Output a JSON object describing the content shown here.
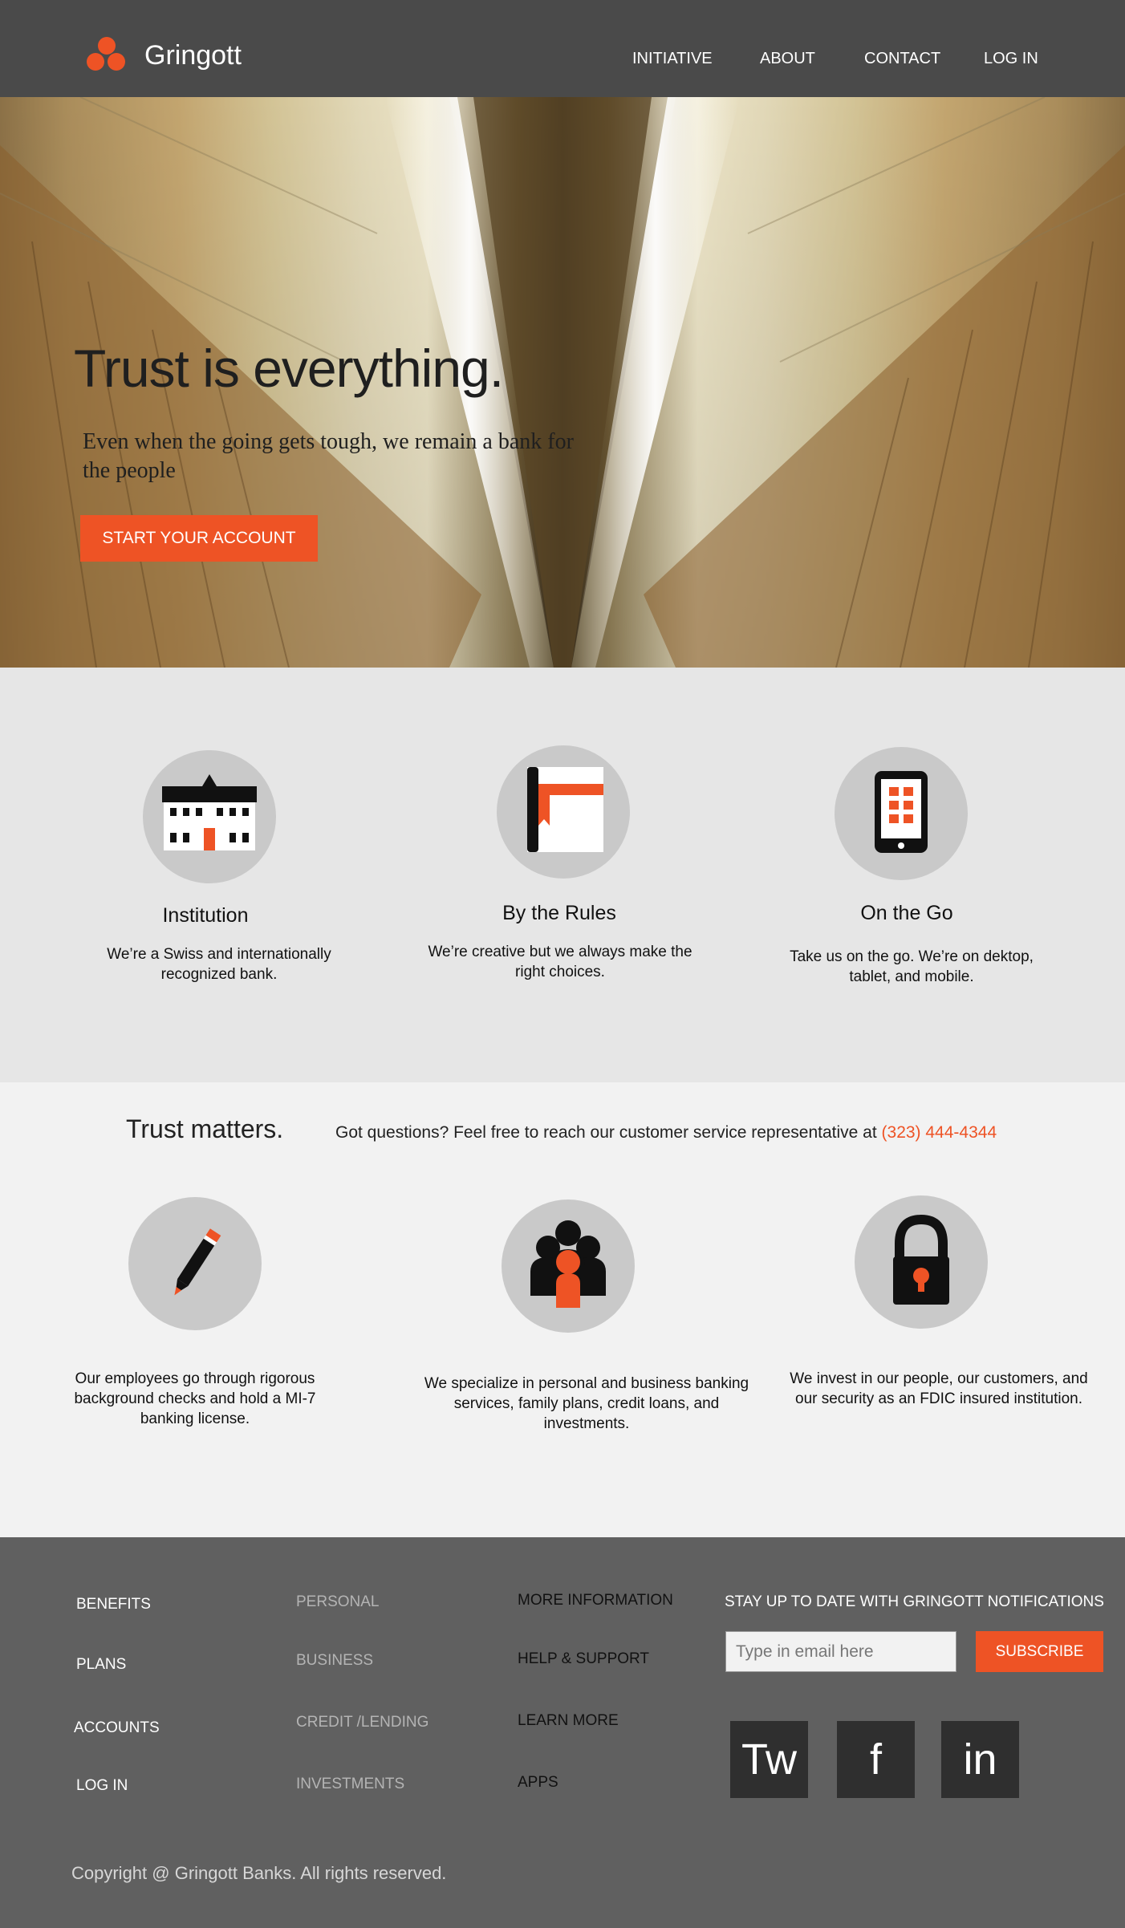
{
  "header": {
    "brand": "Gringott",
    "nav": [
      "INITIATIVE",
      "ABOUT",
      "CONTACT",
      "LOG IN"
    ]
  },
  "hero": {
    "title": "Trust is everything.",
    "subtitle": "Even when the going gets tough, we remain a bank for the people",
    "cta": "START YOUR ACCOUNT"
  },
  "features": [
    {
      "icon": "bank-building-icon",
      "title": "Institution",
      "text": "We’re a Swiss and internationally recognized bank."
    },
    {
      "icon": "rule-book-icon",
      "title": "By the Rules",
      "text": "We’re creative but we always make the right choices."
    },
    {
      "icon": "mobile-phone-icon",
      "title": "On the Go",
      "text": "Take us on the go. We’re on dektop, tablet, and mobile."
    }
  ],
  "trust": {
    "title": "Trust matters.",
    "question": "Got questions? Feel free to reach our customer service representative at ",
    "phone": "(323) 444-4344",
    "items": [
      {
        "icon": "pencil-icon",
        "text": "Our  employees go through rigorous background checks and hold a MI-7 banking license."
      },
      {
        "icon": "people-group-icon",
        "text": "We specialize in personal and business banking services, family plans, credit loans, and investments."
      },
      {
        "icon": "padlock-icon",
        "text": "We invest in our people, our customers, and our security as an FDIC insured institution."
      }
    ]
  },
  "footer": {
    "col1": [
      "BENEFITS",
      "PLANS",
      "ACCOUNTS",
      "LOG IN"
    ],
    "col2": [
      "PERSONAL",
      "BUSINESS",
      "CREDIT /LENDING",
      "INVESTMENTS"
    ],
    "col3": [
      "MORE INFORMATION",
      "HELP & SUPPORT",
      "LEARN MORE",
      "APPS"
    ],
    "newsletter": "STAY UP TO DATE WITH GRINGOTT NOTIFICATIONS",
    "email_placeholder": "Type in email here",
    "subscribe": "SUBSCRIBE",
    "social": [
      "Tw",
      "f",
      "in"
    ],
    "copyright": "Copyright @ Gringott Banks. All rights reserved."
  },
  "colors": {
    "accent": "#ee5325",
    "header": "#4a4a4a",
    "footer": "#606060"
  }
}
